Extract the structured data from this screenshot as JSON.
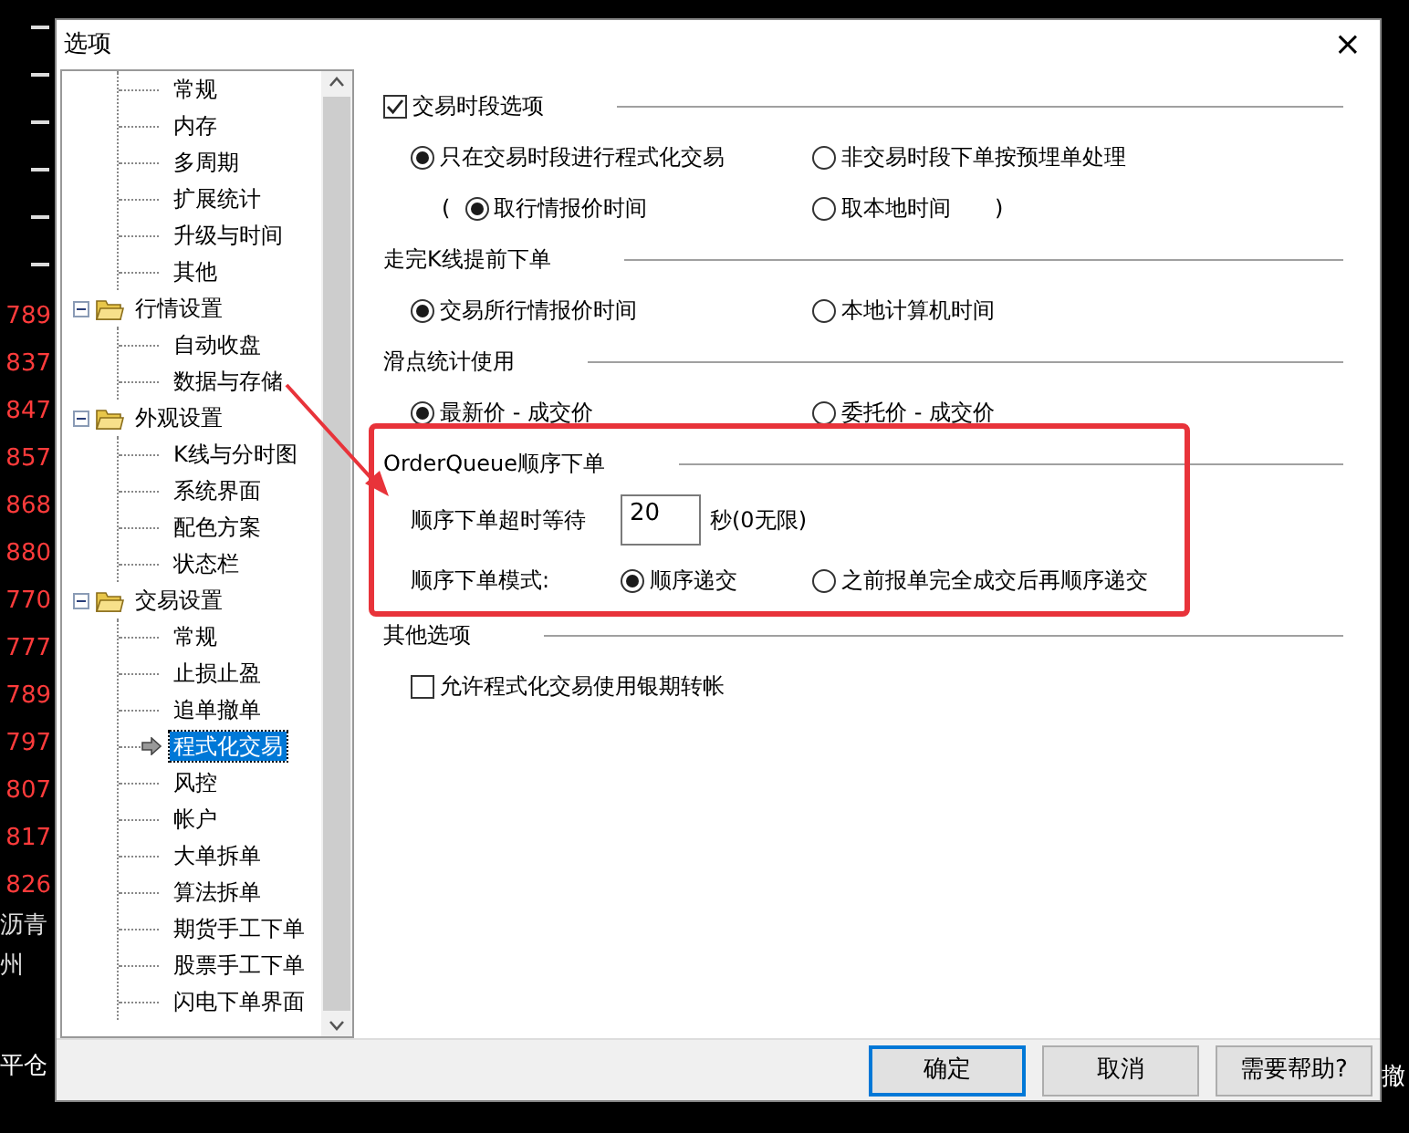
{
  "background": {
    "left_texts": [
      {
        "text": "789",
        "kind": "price"
      },
      {
        "text": "837",
        "kind": "price"
      },
      {
        "text": "847",
        "kind": "price"
      },
      {
        "text": "857",
        "kind": "price"
      },
      {
        "text": "868",
        "kind": "price"
      },
      {
        "text": "880",
        "kind": "price"
      },
      {
        "text": "770",
        "kind": "price"
      },
      {
        "text": "777",
        "kind": "price"
      },
      {
        "text": "789",
        "kind": "price"
      },
      {
        "text": "797",
        "kind": "price"
      },
      {
        "text": "807",
        "kind": "price"
      },
      {
        "text": "817",
        "kind": "price"
      },
      {
        "text": "826",
        "kind": "price"
      },
      {
        "text": "沥青",
        "kind": "name"
      },
      {
        "text": "州",
        "kind": "name"
      },
      {
        "text": "平仓",
        "kind": "action"
      }
    ],
    "right_texts": [
      "撤"
    ]
  },
  "window": {
    "title": "选项",
    "close": "×"
  },
  "tree": [
    {
      "children": [
        {
          "label": "常规",
          "selected": false
        },
        {
          "label": "内存",
          "selected": false
        },
        {
          "label": "多周期",
          "selected": false
        },
        {
          "label": "扩展统计",
          "selected": false
        },
        {
          "label": "升级与时间",
          "selected": false
        },
        {
          "label": "其他",
          "selected": false
        }
      ]
    },
    {
      "label": "行情设置",
      "expanded": true,
      "children": [
        {
          "label": "自动收盘",
          "selected": false
        },
        {
          "label": "数据与存储",
          "selected": false
        }
      ]
    },
    {
      "label": "外观设置",
      "expanded": true,
      "children": [
        {
          "label": "K线与分时图",
          "selected": false
        },
        {
          "label": "系统界面",
          "selected": false
        },
        {
          "label": "配色方案",
          "selected": false
        },
        {
          "label": "状态栏",
          "selected": false
        }
      ]
    },
    {
      "label": "交易设置",
      "expanded": true,
      "children": [
        {
          "label": "常规",
          "selected": false
        },
        {
          "label": "止损止盈",
          "selected": false
        },
        {
          "label": "追单撤单",
          "selected": false
        },
        {
          "label": "程式化交易",
          "selected": true
        },
        {
          "label": "风控",
          "selected": false
        },
        {
          "label": "帐户",
          "selected": false
        },
        {
          "label": "大单拆单",
          "selected": false
        },
        {
          "label": "算法拆单",
          "selected": false
        },
        {
          "label": "期货手工下单",
          "selected": false
        },
        {
          "label": "股票手工下单",
          "selected": false
        },
        {
          "label": "闪电下单界面",
          "selected": false
        }
      ]
    }
  ],
  "sections": [
    {
      "title": "交易时段选项",
      "kind": "checkbox",
      "checked": true,
      "rows": [
        {
          "kind": "radios",
          "options": [
            {
              "label": "只在交易时段进行程式化交易",
              "selected": true
            },
            {
              "label": "非交易时段下单按预埋单处理",
              "selected": false
            }
          ]
        },
        {
          "kind": "radios",
          "prefix": "(",
          "suffix": ")",
          "options": [
            {
              "label": "取行情报价时间",
              "selected": true
            },
            {
              "label": "取本地时间",
              "selected": false
            }
          ]
        }
      ]
    },
    {
      "title": "走完K线提前下单",
      "kind": "heading",
      "rows": [
        {
          "kind": "radios",
          "options": [
            {
              "label": "交易所行情报价时间",
              "selected": true
            },
            {
              "label": "本地计算机时间",
              "selected": false
            }
          ]
        }
      ]
    },
    {
      "title": "滑点统计使用",
      "kind": "heading",
      "rows": [
        {
          "kind": "radios",
          "options": [
            {
              "label": "最新价 - 成交价",
              "selected": true
            },
            {
              "label": "委托价 - 成交价",
              "selected": false
            }
          ]
        }
      ]
    },
    {
      "title": "OrderQueue顺序下单",
      "kind": "heading",
      "highlighted": true,
      "rows": [
        {
          "kind": "field",
          "label": "顺序下单超时等待",
          "value": "20",
          "unit": "秒(0无限)"
        },
        {
          "kind": "labeled_radios",
          "label": "顺序下单模式:",
          "options": [
            {
              "label": "顺序递交",
              "selected": true
            },
            {
              "label": "之前报单完全成交后再顺序递交",
              "selected": false
            }
          ]
        }
      ]
    },
    {
      "title": "其他选项",
      "kind": "heading",
      "rows": [
        {
          "kind": "checkbox",
          "label": "允许程式化交易使用银期转帐",
          "checked": false
        }
      ]
    }
  ],
  "buttons": [
    {
      "label": "确定",
      "default": true
    },
    {
      "label": "取消",
      "default": false
    },
    {
      "label": "需要帮助?",
      "default": false
    }
  ]
}
